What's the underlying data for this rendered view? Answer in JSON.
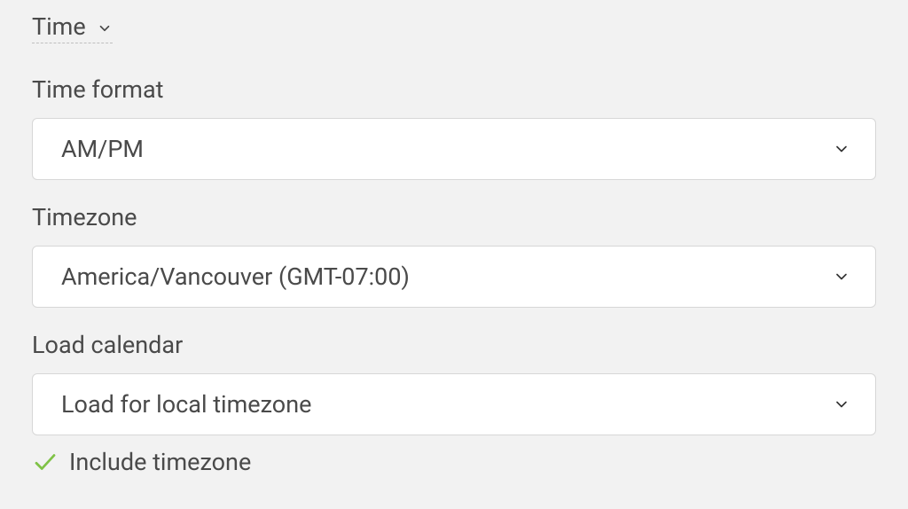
{
  "section": {
    "title": "Time"
  },
  "fields": {
    "time_format": {
      "label": "Time format",
      "value": "AM/PM"
    },
    "timezone": {
      "label": "Timezone",
      "value": "America/Vancouver (GMT-07:00)"
    },
    "load_calendar": {
      "label": "Load calendar",
      "value": "Load for local timezone"
    }
  },
  "checkbox": {
    "label": "Include timezone",
    "checked": true
  }
}
